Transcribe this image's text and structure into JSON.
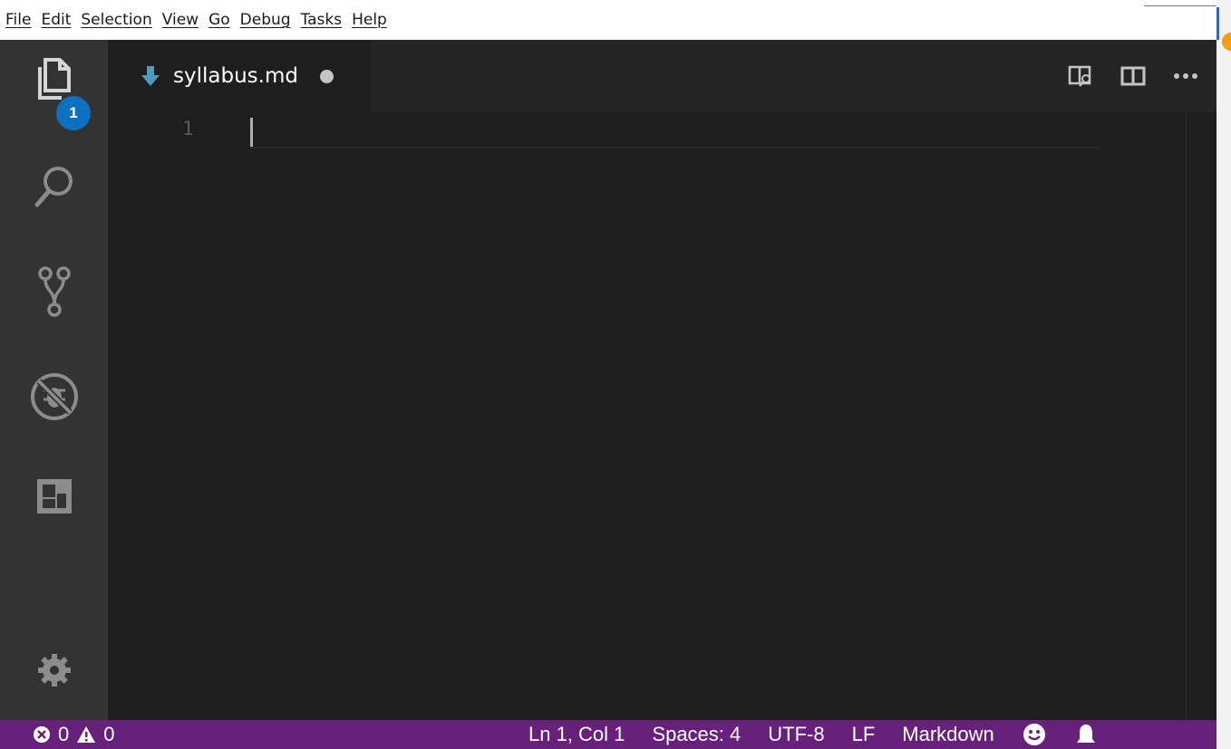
{
  "menubar": {
    "items": [
      {
        "label": "File"
      },
      {
        "label": "Edit"
      },
      {
        "label": "Selection"
      },
      {
        "label": "View"
      },
      {
        "label": "Go"
      },
      {
        "label": "Debug"
      },
      {
        "label": "Tasks"
      },
      {
        "label": "Help"
      }
    ]
  },
  "activitybar": {
    "explorer_icon": "files-icon",
    "explorer_badge": "1",
    "search_icon": "search-icon",
    "scm_icon": "source-control-icon",
    "debug_icon": "debug-disabled-icon",
    "extensions_icon": "extensions-icon",
    "settings_icon": "gear-icon"
  },
  "editor": {
    "tab": {
      "label": "syllabus.md",
      "icon": "markdown-arrow-icon",
      "dirty": true
    },
    "actions": [
      "open-preview-icon",
      "split-editor-icon",
      "more-icon"
    ],
    "lines": [
      {
        "number": "1",
        "text": ""
      }
    ]
  },
  "statusbar": {
    "errors": "0",
    "warnings": "0",
    "position": "Ln 1, Col 1",
    "spaces": "Spaces: 4",
    "encoding": "UTF-8",
    "eol": "LF",
    "language": "Markdown",
    "feedback_icon": "smiley-icon",
    "notifications_icon": "bell-icon"
  },
  "colors": {
    "statusbar": "#68217a",
    "activitybar": "#333333",
    "editor": "#1e1e1e",
    "badge": "#0e70c0"
  }
}
